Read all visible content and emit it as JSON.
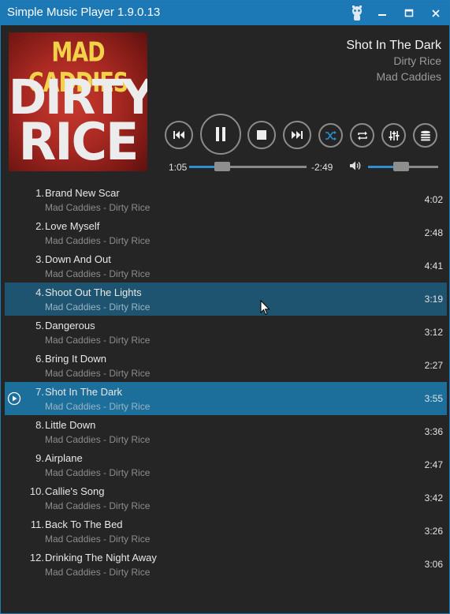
{
  "window": {
    "title": "Simple Music Player 1.9.0.13",
    "controls": {
      "minimize": "−",
      "maximize": "☐",
      "close": "✕"
    }
  },
  "album_art": {
    "line1": "MAD CADDIES",
    "line2": "DIRTY",
    "line3": "RICE"
  },
  "now_playing": {
    "title": "Shot In The Dark",
    "album": "Dirty Rice",
    "artist": "Mad Caddies"
  },
  "playback": {
    "elapsed": "1:05",
    "remaining": "-2:49",
    "progress_fraction": 0.28,
    "volume_fraction": 0.47
  },
  "colors": {
    "accent": "#1c79b6",
    "playing_row": "#1c6f9a",
    "selected_row": "#1e5470"
  },
  "tracks": [
    {
      "num": "1.",
      "title": "Brand New Scar",
      "sub": "Mad Caddies - Dirty Rice",
      "dur": "4:02"
    },
    {
      "num": "2.",
      "title": "Love Myself",
      "sub": "Mad Caddies - Dirty Rice",
      "dur": "2:48"
    },
    {
      "num": "3.",
      "title": "Down And Out",
      "sub": "Mad Caddies - Dirty Rice",
      "dur": "4:41"
    },
    {
      "num": "4.",
      "title": "Shoot Out The Lights",
      "sub": "Mad Caddies - Dirty Rice",
      "dur": "3:19"
    },
    {
      "num": "5.",
      "title": "Dangerous",
      "sub": "Mad Caddies - Dirty Rice",
      "dur": "3:12"
    },
    {
      "num": "6.",
      "title": "Bring It Down",
      "sub": "Mad Caddies - Dirty Rice",
      "dur": "2:27"
    },
    {
      "num": "7.",
      "title": "Shot In The Dark",
      "sub": "Mad Caddies - Dirty Rice",
      "dur": "3:55"
    },
    {
      "num": "8.",
      "title": "Little Down",
      "sub": "Mad Caddies - Dirty Rice",
      "dur": "3:36"
    },
    {
      "num": "9.",
      "title": "Airplane",
      "sub": "Mad Caddies - Dirty Rice",
      "dur": "2:47"
    },
    {
      "num": "10.",
      "title": "Callie's Song",
      "sub": "Mad Caddies - Dirty Rice",
      "dur": "3:42"
    },
    {
      "num": "11.",
      "title": "Back To The Bed",
      "sub": "Mad Caddies - Dirty Rice",
      "dur": "3:26"
    },
    {
      "num": "12.",
      "title": "Drinking The Night Away",
      "sub": "Mad Caddies - Dirty Rice",
      "dur": "3:06"
    }
  ]
}
